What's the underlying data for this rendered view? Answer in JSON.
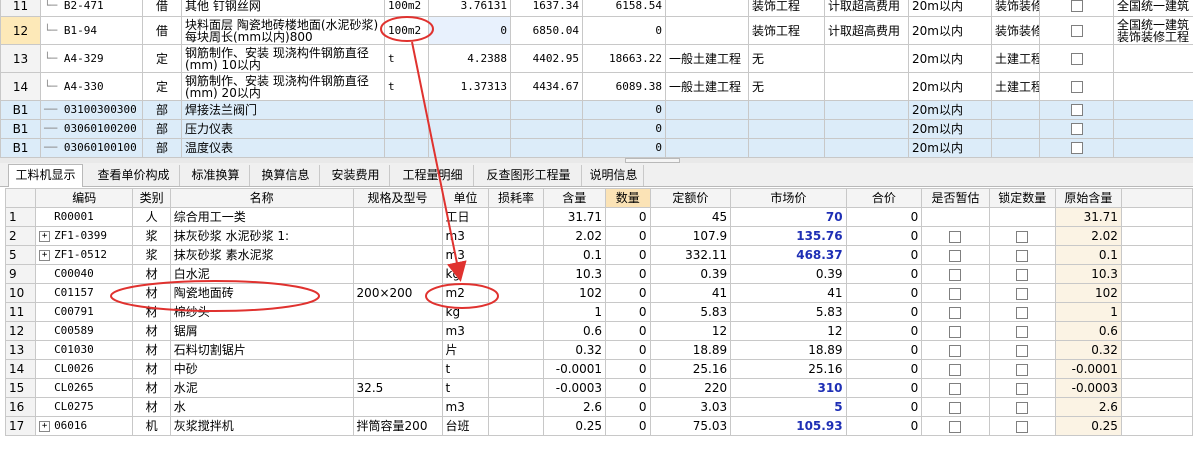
{
  "top_rows": [
    {
      "no": "11",
      "code": "B2-471",
      "type": "借",
      "name": "其他 钉钢丝网",
      "unit": "100m2",
      "qty": "3.76131",
      "price": "1637.34",
      "total": "6158.54",
      "prof": "",
      "cat": "装饰工程",
      "fee": "计取超高费用",
      "height": "20m以内",
      "major": "装饰装修工程",
      "std": "全国统一建筑"
    },
    {
      "no": "12",
      "code": "B1-94",
      "type": "借",
      "name": "块料面层 陶瓷地砖楼地面(水泥砂浆)每块周长(mm以内)800",
      "unit": "100m2",
      "qty": "0",
      "price": "6850.04",
      "total": "0",
      "prof": "",
      "cat": "装饰工程",
      "fee": "计取超高费用",
      "height": "20m以内",
      "major": "装饰装修工程",
      "std": "全国统一建筑装饰装修工程"
    },
    {
      "no": "13",
      "code": "A4-329",
      "type": "定",
      "name": "钢筋制作、安装 现浇构件钢筋直径(mm) 10以内",
      "unit": "t",
      "qty": "4.2388",
      "price": "4402.95",
      "total": "18663.22",
      "prof": "一般土建工程",
      "cat": "无",
      "fee": "",
      "height": "20m以内",
      "major": "土建工程",
      "std": ""
    },
    {
      "no": "14",
      "code": "A4-330",
      "type": "定",
      "name": "钢筋制作、安装 现浇构件钢筋直径(mm) 20以内",
      "unit": "t",
      "qty": "1.37313",
      "price": "4434.67",
      "total": "6089.38",
      "prof": "一般土建工程",
      "cat": "无",
      "fee": "",
      "height": "20m以内",
      "major": "土建工程",
      "std": ""
    },
    {
      "no": "B1",
      "code": "03100300300",
      "type": "部",
      "name": "焊接法兰阀门",
      "unit": "",
      "qty": "",
      "price": "",
      "total": "0",
      "prof": "",
      "cat": "",
      "fee": "",
      "height": "20m以内",
      "major": "",
      "std": ""
    },
    {
      "no": "B1",
      "code": "03060100200",
      "type": "部",
      "name": "压力仪表",
      "unit": "",
      "qty": "",
      "price": "",
      "total": "0",
      "prof": "",
      "cat": "",
      "fee": "",
      "height": "20m以内",
      "major": "",
      "std": ""
    },
    {
      "no": "B1",
      "code": "03060100100",
      "type": "部",
      "name": "温度仪表",
      "unit": "",
      "qty": "",
      "price": "",
      "total": "0",
      "prof": "",
      "cat": "",
      "fee": "",
      "height": "20m以内",
      "major": "",
      "std": ""
    }
  ],
  "tabs": [
    "工料机显示",
    "查看单价构成",
    "标准换算",
    "换算信息",
    "安装费用",
    "工程量明细",
    "反查图形工程量",
    "说明信息"
  ],
  "bottom_headers": [
    "编码",
    "类别",
    "名称",
    "规格及型号",
    "单位",
    "损耗率",
    "含量",
    "数量",
    "定额价",
    "市场价",
    "合价",
    "是否暂估",
    "锁定数量",
    "原始含量"
  ],
  "bottom_rows": [
    {
      "no": "1",
      "exp": false,
      "code": "R00001",
      "cat": "人",
      "name": "综合用工一类",
      "spec": "",
      "unit": "工日",
      "loss": "",
      "content": "31.71",
      "qty": "0",
      "base": "45",
      "market": "70",
      "mblue": true,
      "total": "0",
      "chk": false,
      "orig": "31.71"
    },
    {
      "no": "2",
      "exp": true,
      "code": "ZF1-0399",
      "cat": "浆",
      "name": "抹灰砂浆 水泥砂浆 1:",
      "spec": "",
      "unit": "m3",
      "loss": "",
      "content": "2.02",
      "qty": "0",
      "base": "107.9",
      "market": "135.76",
      "mblue": true,
      "total": "0",
      "chk": true,
      "orig": "2.02"
    },
    {
      "no": "5",
      "exp": true,
      "code": "ZF1-0512",
      "cat": "浆",
      "name": "抹灰砂浆 素水泥浆",
      "spec": "",
      "unit": "m3",
      "loss": "",
      "content": "0.1",
      "qty": "0",
      "base": "332.11",
      "market": "468.37",
      "mblue": true,
      "total": "0",
      "chk": true,
      "orig": "0.1"
    },
    {
      "no": "9",
      "exp": false,
      "code": "C00040",
      "cat": "材",
      "name": "白水泥",
      "spec": "",
      "unit": "kg",
      "loss": "",
      "content": "10.3",
      "qty": "0",
      "base": "0.39",
      "market": "0.39",
      "mblue": false,
      "total": "0",
      "chk": true,
      "orig": "10.3"
    },
    {
      "no": "10",
      "exp": false,
      "code": "C01157",
      "cat": "材",
      "name": "陶瓷地面砖",
      "spec": "200×200",
      "unit": "m2",
      "loss": "",
      "content": "102",
      "qty": "0",
      "base": "41",
      "market": "41",
      "mblue": false,
      "total": "0",
      "chk": true,
      "orig": "102"
    },
    {
      "no": "11",
      "exp": false,
      "code": "C00791",
      "cat": "材",
      "name": "棉纱头",
      "spec": "",
      "unit": "kg",
      "loss": "",
      "content": "1",
      "qty": "0",
      "base": "5.83",
      "market": "5.83",
      "mblue": false,
      "total": "0",
      "chk": true,
      "orig": "1"
    },
    {
      "no": "12",
      "exp": false,
      "code": "C00589",
      "cat": "材",
      "name": "锯屑",
      "spec": "",
      "unit": "m3",
      "loss": "",
      "content": "0.6",
      "qty": "0",
      "base": "12",
      "market": "12",
      "mblue": false,
      "total": "0",
      "chk": true,
      "orig": "0.6"
    },
    {
      "no": "13",
      "exp": false,
      "code": "C01030",
      "cat": "材",
      "name": "石料切割锯片",
      "spec": "",
      "unit": "片",
      "loss": "",
      "content": "0.32",
      "qty": "0",
      "base": "18.89",
      "market": "18.89",
      "mblue": false,
      "total": "0",
      "chk": true,
      "orig": "0.32"
    },
    {
      "no": "14",
      "exp": false,
      "code": "CL0026",
      "cat": "材",
      "name": "中砂",
      "spec": "",
      "unit": "t",
      "loss": "",
      "content": "-0.0001",
      "qty": "0",
      "base": "25.16",
      "market": "25.16",
      "mblue": false,
      "total": "0",
      "chk": true,
      "orig": "-0.0001"
    },
    {
      "no": "15",
      "exp": false,
      "code": "CL0265",
      "cat": "材",
      "name": "水泥",
      "spec": "32.5",
      "unit": "t",
      "loss": "",
      "content": "-0.0003",
      "qty": "0",
      "base": "220",
      "market": "310",
      "mblue": true,
      "total": "0",
      "chk": true,
      "orig": "-0.0003"
    },
    {
      "no": "16",
      "exp": false,
      "code": "CL0275",
      "cat": "材",
      "name": "水",
      "spec": "",
      "unit": "m3",
      "loss": "",
      "content": "2.6",
      "qty": "0",
      "base": "3.03",
      "market": "5",
      "mblue": true,
      "total": "0",
      "chk": true,
      "orig": "2.6"
    },
    {
      "no": "17",
      "exp": true,
      "code": "06016",
      "cat": "机",
      "name": "灰浆搅拌机",
      "spec": "拌筒容量200",
      "unit": "台班",
      "loss": "",
      "content": "0.25",
      "qty": "0",
      "base": "75.03",
      "market": "105.93",
      "mblue": true,
      "total": "0",
      "chk": true,
      "orig": "0.25"
    }
  ],
  "colors": {
    "annotation": "#e0322f",
    "selected_row": "#fde9b8",
    "section_row": "#dcecf9",
    "blue_price": "#1e2fb5"
  }
}
